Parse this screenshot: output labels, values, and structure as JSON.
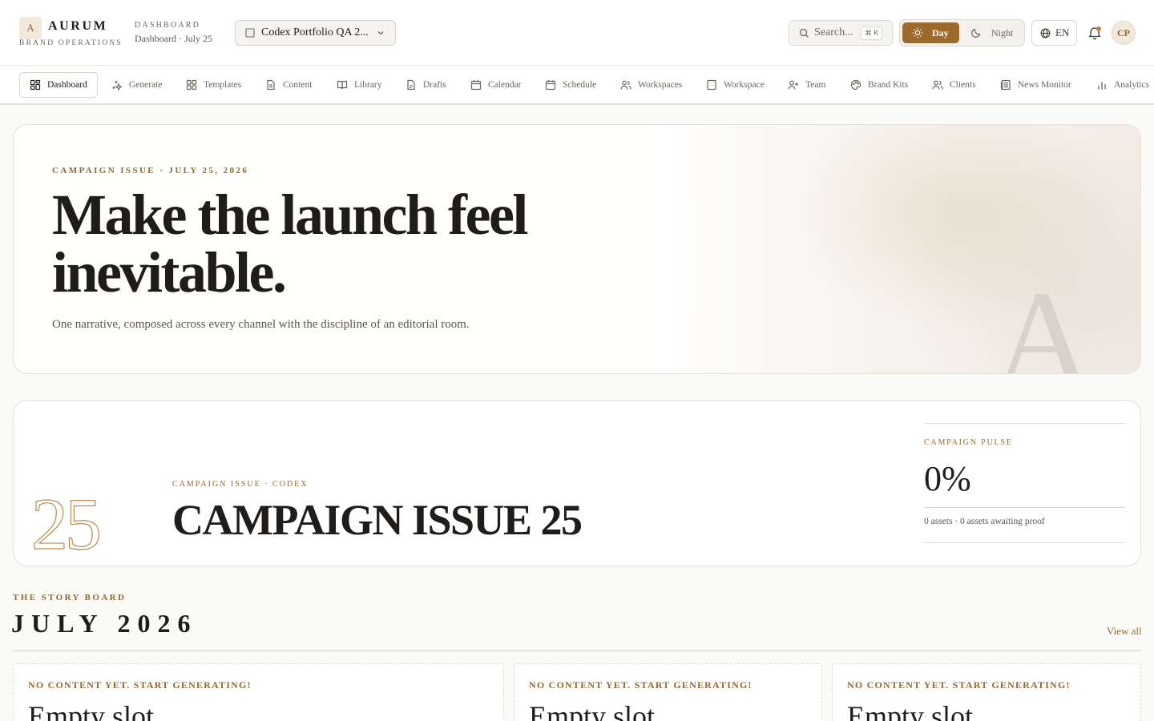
{
  "brand": {
    "mark": "A",
    "name": "AURUM",
    "subtitle": "BRAND OPERATIONS"
  },
  "breadcrumb": {
    "label": "DASHBOARD",
    "sub": "Dashboard · July 25"
  },
  "workspace": {
    "value": "Codex Portfolio QA 2..."
  },
  "search": {
    "placeholder": "Search...",
    "shortcut": "⌘ K"
  },
  "theme": {
    "day_label": "Day",
    "night_label": "Night",
    "active": "day"
  },
  "language": {
    "label": "EN"
  },
  "user": {
    "initials": "CP"
  },
  "colors": {
    "accent": "#9c6a2a",
    "accent_text": "#8f6a35",
    "ink": "#1f1c19"
  },
  "nav": {
    "items": [
      {
        "label": "Dashboard",
        "icon": "dashboard-icon",
        "active": true
      },
      {
        "label": "Generate",
        "icon": "sparkle-icon"
      },
      {
        "label": "Templates",
        "icon": "grid-icon"
      },
      {
        "label": "Content",
        "icon": "document-icon"
      },
      {
        "label": "Library",
        "icon": "book-icon"
      },
      {
        "label": "Drafts",
        "icon": "draft-icon"
      },
      {
        "label": "Calendar",
        "icon": "calendar-icon"
      },
      {
        "label": "Schedule",
        "icon": "schedule-icon"
      },
      {
        "label": "Workspaces",
        "icon": "users-icon"
      },
      {
        "label": "Workspace",
        "icon": "building-icon"
      },
      {
        "label": "Team",
        "icon": "user-plus-icon"
      },
      {
        "label": "Brand Kits",
        "icon": "palette-icon"
      },
      {
        "label": "Clients",
        "icon": "clients-icon"
      },
      {
        "label": "News Monitor",
        "icon": "newspaper-icon"
      },
      {
        "label": "Analytics",
        "icon": "bar-chart-icon"
      }
    ]
  },
  "hero": {
    "eyebrow": "CAMPAIGN ISSUE · JULY 25, 2026",
    "title": "Make the launch feel inevitable.",
    "subtitle": "One narrative, composed across every channel with the discipline of an editorial room.",
    "watermark": "A"
  },
  "campaign": {
    "number": "25",
    "eyebrow": "CAMPAIGN ISSUE · CODEX",
    "title": "CAMPAIGN ISSUE 25",
    "pulse": {
      "label": "CAMPAIGN PULSE",
      "value": "0%",
      "meta": "0 assets · 0 assets awaiting proof"
    }
  },
  "storyboard": {
    "eyebrow": "THE STORY BOARD",
    "title": "JULY 2026",
    "view_all": "View all",
    "slots": [
      {
        "label": "NO CONTENT YET. START GENERATING!",
        "title": "Empty slot"
      },
      {
        "label": "NO CONTENT YET. START GENERATING!",
        "title": "Empty slot"
      },
      {
        "label": "NO CONTENT YET. START GENERATING!",
        "title": "Empty slot"
      }
    ]
  }
}
